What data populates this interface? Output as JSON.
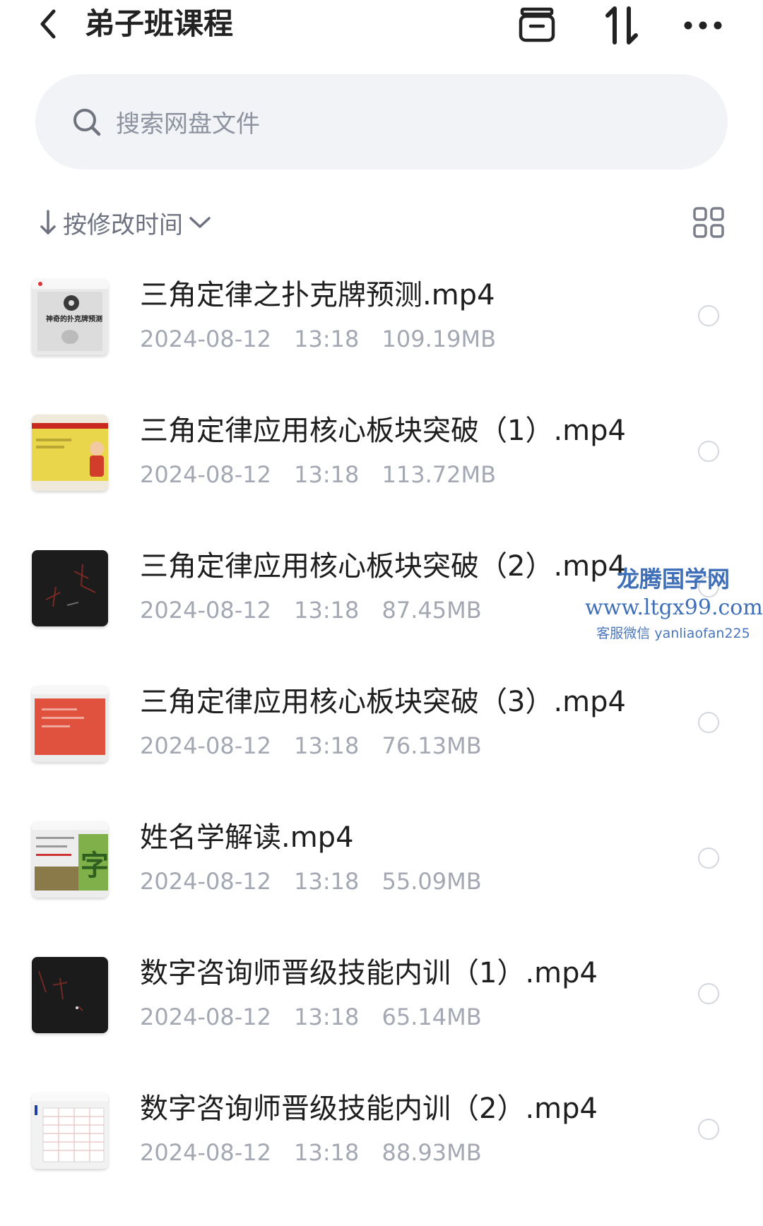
{
  "header": {
    "title": "弟子班课程",
    "back_icon": "chevron-left-icon",
    "actions": [
      "archive-icon",
      "transfer-icon",
      "more-icon"
    ]
  },
  "search": {
    "placeholder": "搜索网盘文件"
  },
  "sort": {
    "label": "按修改时间",
    "direction": "descending",
    "view_toggle_icon": "grid-view-icon"
  },
  "files": [
    {
      "name": "三角定律之扑克牌预测.mp4",
      "date": "2024-08-12",
      "time": "13:18",
      "size": "109.19MB",
      "thumb_text": "神奇的扑克牌预测"
    },
    {
      "name": "三角定律应用核心板块突破（1）.mp4",
      "date": "2024-08-12",
      "time": "13:18",
      "size": "113.72MB"
    },
    {
      "name": "三角定律应用核心板块突破（2）.mp4",
      "date": "2024-08-12",
      "time": "13:18",
      "size": "87.45MB"
    },
    {
      "name": "三角定律应用核心板块突破（3）.mp4",
      "date": "2024-08-12",
      "time": "13:18",
      "size": "76.13MB"
    },
    {
      "name": "姓名学解读.mp4",
      "date": "2024-08-12",
      "time": "13:18",
      "size": "55.09MB",
      "thumb_text": "字"
    },
    {
      "name": "数字咨询师晋级技能内训（1）.mp4",
      "date": "2024-08-12",
      "time": "13:18",
      "size": "65.14MB"
    },
    {
      "name": "数字咨询师晋级技能内训（2）.mp4",
      "date": "2024-08-12",
      "time": "13:18",
      "size": "88.93MB"
    }
  ],
  "watermark": {
    "line1": "龙腾国学网",
    "line2": "www.ltgx99.com",
    "line3": "客服微信 yanliaofan225"
  },
  "colors": {
    "title_text": "#222222",
    "meta_text": "#a4a8b2",
    "search_bg": "#f2f3f7",
    "watermark": "#3f6fb8"
  }
}
